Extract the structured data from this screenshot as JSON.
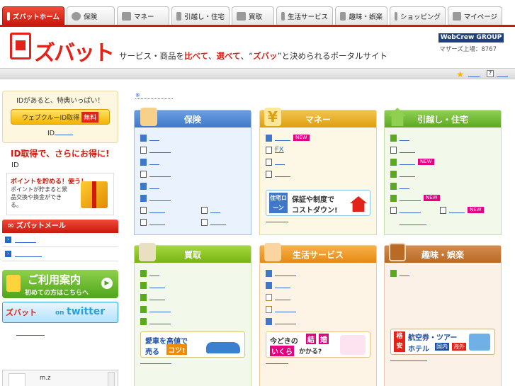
{
  "tabs": [
    {
      "label": "ズバットホーム",
      "icon": "home-icon",
      "active": true
    },
    {
      "label": "保険",
      "icon": "heart-icon"
    },
    {
      "label": "マネー",
      "icon": "yen-icon"
    },
    {
      "label": "引越し・住宅",
      "icon": "house-icon"
    },
    {
      "label": "買取",
      "icon": "car-icon"
    },
    {
      "label": "生活サービス",
      "icon": "person-icon"
    },
    {
      "label": "趣味・娯楽",
      "icon": "book-icon"
    },
    {
      "label": "ショッピング",
      "icon": "cart-icon"
    },
    {
      "label": "マイページ",
      "icon": "user-icon"
    }
  ],
  "header": {
    "logo": "ズバット",
    "tagline_a": "サービス・商品を",
    "tagline_b": "比べて",
    "tagline_c": "、",
    "tagline_d": "選べて",
    "tagline_e": "、“",
    "tagline_f": "ズバッ",
    "tagline_g": "”と決められるポータルサイト",
    "webcrew": "WebCrew GROUP",
    "members": "マザーズ上場：8767"
  },
  "sidebar": {
    "id_promo": "IDがあると、特典いっぱい！",
    "id_button": "ウェブクルーID取得",
    "free_badge": "無料",
    "id_link": "ID",
    "get_id_title": "ID取得で、さらにお得に!",
    "id_text": "ID",
    "points_title": "ポイントを貯める！使う！",
    "points_text": "ポイントが貯まると景品交換や換金ができる。",
    "mail_title": "ズバットメール",
    "guide_main": "ご利用案内",
    "guide_sub": "初めての方はこちらへ",
    "twitter_logo": "ズバット",
    "twitter_on": "on",
    "twitter_word": "twitter",
    "tweet_name": "m.z"
  },
  "top_note": "※",
  "categories": {
    "hoken": {
      "title": "保険",
      "color": "#3f78c9"
    },
    "money": {
      "title": "マネー",
      "color": "#de9f10",
      "fx_label": "FX",
      "new_badge": "NEW",
      "banner_tag": "住宅ローン",
      "banner_l1": "保証や制度で",
      "banner_l2": "コストダウン!"
    },
    "housing": {
      "title": "引越し・住宅",
      "color": "#5ba921",
      "new_badge": "NEW"
    },
    "kaitori": {
      "title": "買取",
      "color": "#78b314",
      "banner_l1": "愛車を高値で",
      "banner_l2": "売る",
      "banner_l3": "コツ!"
    },
    "life": {
      "title": "生活サービス",
      "color": "#e68a12",
      "banner_l1": "今どきの",
      "banner_l2": "結",
      "banner_l3": "婚",
      "banner_l4": "いくら",
      "banner_l5": "かかる?"
    },
    "hobby": {
      "title": "趣味・娯楽",
      "color": "#b96a25",
      "banner_tag": "格安",
      "banner_l1": "航空券・ツアー",
      "banner_l2": "ホテル",
      "banner_l3": "国内",
      "banner_l4": "海外"
    }
  }
}
